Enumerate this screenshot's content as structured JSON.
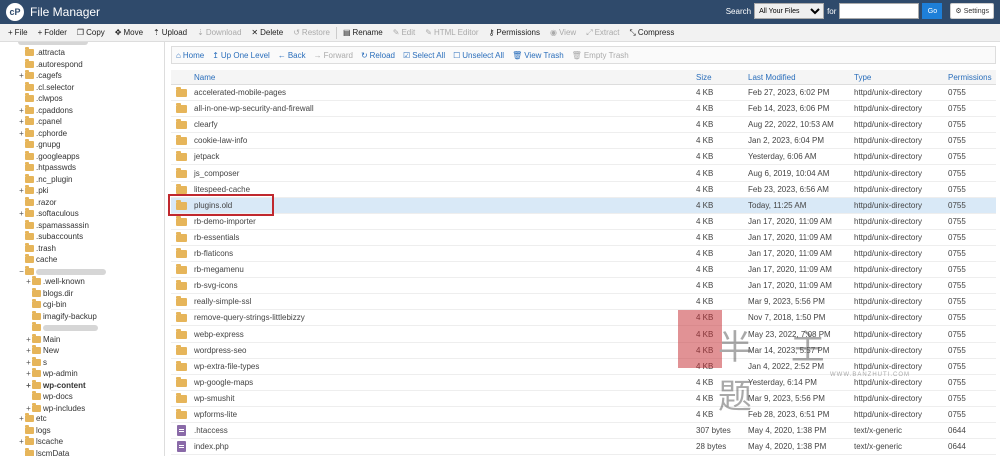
{
  "header": {
    "logo_text": "cP",
    "title": "File Manager",
    "search_label": "Search",
    "search_scope": "All Your Files",
    "for_label": "for",
    "search_value": "",
    "go_label": "Go",
    "settings_label": "Settings"
  },
  "toolbar": {
    "file": "File",
    "folder": "Folder",
    "copy": "Copy",
    "move": "Move",
    "upload": "Upload",
    "download": "Download",
    "delete": "Delete",
    "restore": "Restore",
    "rename": "Rename",
    "edit": "Edit",
    "html_editor": "HTML Editor",
    "permissions": "Permissions",
    "view": "View",
    "extract": "Extract",
    "compress": "Compress"
  },
  "nav": {
    "home": "Home",
    "up_one_level": "Up One Level",
    "back": "Back",
    "forward": "Forward",
    "reload": "Reload",
    "select_all": "Select All",
    "unselect_all": "Unselect All",
    "view_trash": "View Trash",
    "empty_trash": "Empty Trash"
  },
  "tree": [
    {
      "label": ".attracta",
      "exp": ""
    },
    {
      "label": ".autorespond",
      "exp": ""
    },
    {
      "label": ".cagefs",
      "exp": "+"
    },
    {
      "label": ".cl.selector",
      "exp": ""
    },
    {
      "label": ".clwpos",
      "exp": ""
    },
    {
      "label": ".cpaddons",
      "exp": "+"
    },
    {
      "label": ".cpanel",
      "exp": "+"
    },
    {
      "label": ".cphorde",
      "exp": "+"
    },
    {
      "label": ".gnupg",
      "exp": ""
    },
    {
      "label": ".googleapps",
      "exp": ""
    },
    {
      "label": ".htpasswds",
      "exp": ""
    },
    {
      "label": ".nc_plugin",
      "exp": ""
    },
    {
      "label": ".pki",
      "exp": "+"
    },
    {
      "label": ".razor",
      "exp": ""
    },
    {
      "label": ".softaculous",
      "exp": "+"
    },
    {
      "label": ".spamassassin",
      "exp": ""
    },
    {
      "label": ".subaccounts",
      "exp": ""
    },
    {
      "label": ".trash",
      "exp": ""
    },
    {
      "label": "cache",
      "exp": ""
    }
  ],
  "subtree": [
    {
      "label": ".well-known",
      "exp": "+"
    },
    {
      "label": "blogs.dir",
      "exp": ""
    },
    {
      "label": "cgi-bin",
      "exp": ""
    },
    {
      "label": "imagify-backup",
      "exp": ""
    },
    {
      "label": "",
      "exp": ""
    },
    {
      "label": "Main",
      "exp": "+"
    },
    {
      "label": "New",
      "exp": "+"
    },
    {
      "label": "s",
      "exp": "+"
    },
    {
      "label": "wp-admin",
      "exp": "+"
    },
    {
      "label": "wp-content",
      "exp": "+"
    },
    {
      "label": "wp-docs",
      "exp": ""
    },
    {
      "label": "wp-includes",
      "exp": "+"
    }
  ],
  "tree_bottom": [
    {
      "label": "etc",
      "exp": "+"
    },
    {
      "label": "logs",
      "exp": ""
    },
    {
      "label": "lscache",
      "exp": "+"
    },
    {
      "label": "lscmData",
      "exp": ""
    }
  ],
  "columns": {
    "name": "Name",
    "size": "Size",
    "modified": "Last Modified",
    "type": "Type",
    "perms": "Permissions"
  },
  "files": [
    {
      "name": "accelerated-mobile-pages",
      "size": "4 KB",
      "modified": "Feb 27, 2023, 6:02 PM",
      "type": "httpd/unix-directory",
      "perms": "0755",
      "kind": "folder"
    },
    {
      "name": "all-in-one-wp-security-and-firewall",
      "size": "4 KB",
      "modified": "Feb 14, 2023, 6:06 PM",
      "type": "httpd/unix-directory",
      "perms": "0755",
      "kind": "folder"
    },
    {
      "name": "clearfy",
      "size": "4 KB",
      "modified": "Aug 22, 2022, 10:53 AM",
      "type": "httpd/unix-directory",
      "perms": "0755",
      "kind": "folder"
    },
    {
      "name": "cookie-law-info",
      "size": "4 KB",
      "modified": "Jan 2, 2023, 6:04 PM",
      "type": "httpd/unix-directory",
      "perms": "0755",
      "kind": "folder"
    },
    {
      "name": "jetpack",
      "size": "4 KB",
      "modified": "Yesterday, 6:06 AM",
      "type": "httpd/unix-directory",
      "perms": "0755",
      "kind": "folder"
    },
    {
      "name": "js_composer",
      "size": "4 KB",
      "modified": "Aug 6, 2019, 10:04 AM",
      "type": "httpd/unix-directory",
      "perms": "0755",
      "kind": "folder"
    },
    {
      "name": "litespeed-cache",
      "size": "4 KB",
      "modified": "Feb 23, 2023, 6:56 AM",
      "type": "httpd/unix-directory",
      "perms": "0755",
      "kind": "folder"
    },
    {
      "name": "plugins.old",
      "size": "4 KB",
      "modified": "Today, 11:25 AM",
      "type": "httpd/unix-directory",
      "perms": "0755",
      "kind": "folder",
      "selected": true
    },
    {
      "name": "rb-demo-importer",
      "size": "4 KB",
      "modified": "Jan 17, 2020, 11:09 AM",
      "type": "httpd/unix-directory",
      "perms": "0755",
      "kind": "folder"
    },
    {
      "name": "rb-essentials",
      "size": "4 KB",
      "modified": "Jan 17, 2020, 11:09 AM",
      "type": "httpd/unix-directory",
      "perms": "0755",
      "kind": "folder"
    },
    {
      "name": "rb-flaticons",
      "size": "4 KB",
      "modified": "Jan 17, 2020, 11:09 AM",
      "type": "httpd/unix-directory",
      "perms": "0755",
      "kind": "folder"
    },
    {
      "name": "rb-megamenu",
      "size": "4 KB",
      "modified": "Jan 17, 2020, 11:09 AM",
      "type": "httpd/unix-directory",
      "perms": "0755",
      "kind": "folder"
    },
    {
      "name": "rb-svg-icons",
      "size": "4 KB",
      "modified": "Jan 17, 2020, 11:09 AM",
      "type": "httpd/unix-directory",
      "perms": "0755",
      "kind": "folder"
    },
    {
      "name": "really-simple-ssl",
      "size": "4 KB",
      "modified": "Mar 9, 2023, 5:56 PM",
      "type": "httpd/unix-directory",
      "perms": "0755",
      "kind": "folder"
    },
    {
      "name": "remove-query-strings-littlebizzy",
      "size": "4 KB",
      "modified": "Nov 7, 2018, 1:50 PM",
      "type": "httpd/unix-directory",
      "perms": "0755",
      "kind": "folder"
    },
    {
      "name": "webp-express",
      "size": "4 KB",
      "modified": "May 23, 2022, 7:08 PM",
      "type": "httpd/unix-directory",
      "perms": "0755",
      "kind": "folder"
    },
    {
      "name": "wordpress-seo",
      "size": "4 KB",
      "modified": "Mar 14, 2023, 5:57 PM",
      "type": "httpd/unix-directory",
      "perms": "0755",
      "kind": "folder"
    },
    {
      "name": "wp-extra-file-types",
      "size": "4 KB",
      "modified": "Jan 4, 2022, 2:52 PM",
      "type": "httpd/unix-directory",
      "perms": "0755",
      "kind": "folder"
    },
    {
      "name": "wp-google-maps",
      "size": "4 KB",
      "modified": "Yesterday, 6:14 PM",
      "type": "httpd/unix-directory",
      "perms": "0755",
      "kind": "folder"
    },
    {
      "name": "wp-smushit",
      "size": "4 KB",
      "modified": "Mar 9, 2023, 5:56 PM",
      "type": "httpd/unix-directory",
      "perms": "0755",
      "kind": "folder"
    },
    {
      "name": "wpforms-lite",
      "size": "4 KB",
      "modified": "Feb 28, 2023, 6:51 PM",
      "type": "httpd/unix-directory",
      "perms": "0755",
      "kind": "folder"
    },
    {
      "name": ".htaccess",
      "size": "307 bytes",
      "modified": "May 4, 2020, 1:38 PM",
      "type": "text/x-generic",
      "perms": "0644",
      "kind": "file"
    },
    {
      "name": "index.php",
      "size": "28 bytes",
      "modified": "May 4, 2020, 1:38 PM",
      "type": "text/x-generic",
      "perms": "0644",
      "kind": "file"
    }
  ],
  "watermark": {
    "text": "半 主 题",
    "url": "WWW.BANZHUTI.COM"
  },
  "colors": {
    "header_bg": "#2f4a6b",
    "link": "#2a6ebb",
    "selected_row": "#d9e9f7",
    "highlight_border": "#c0282e",
    "folder": "#e6b55a"
  }
}
